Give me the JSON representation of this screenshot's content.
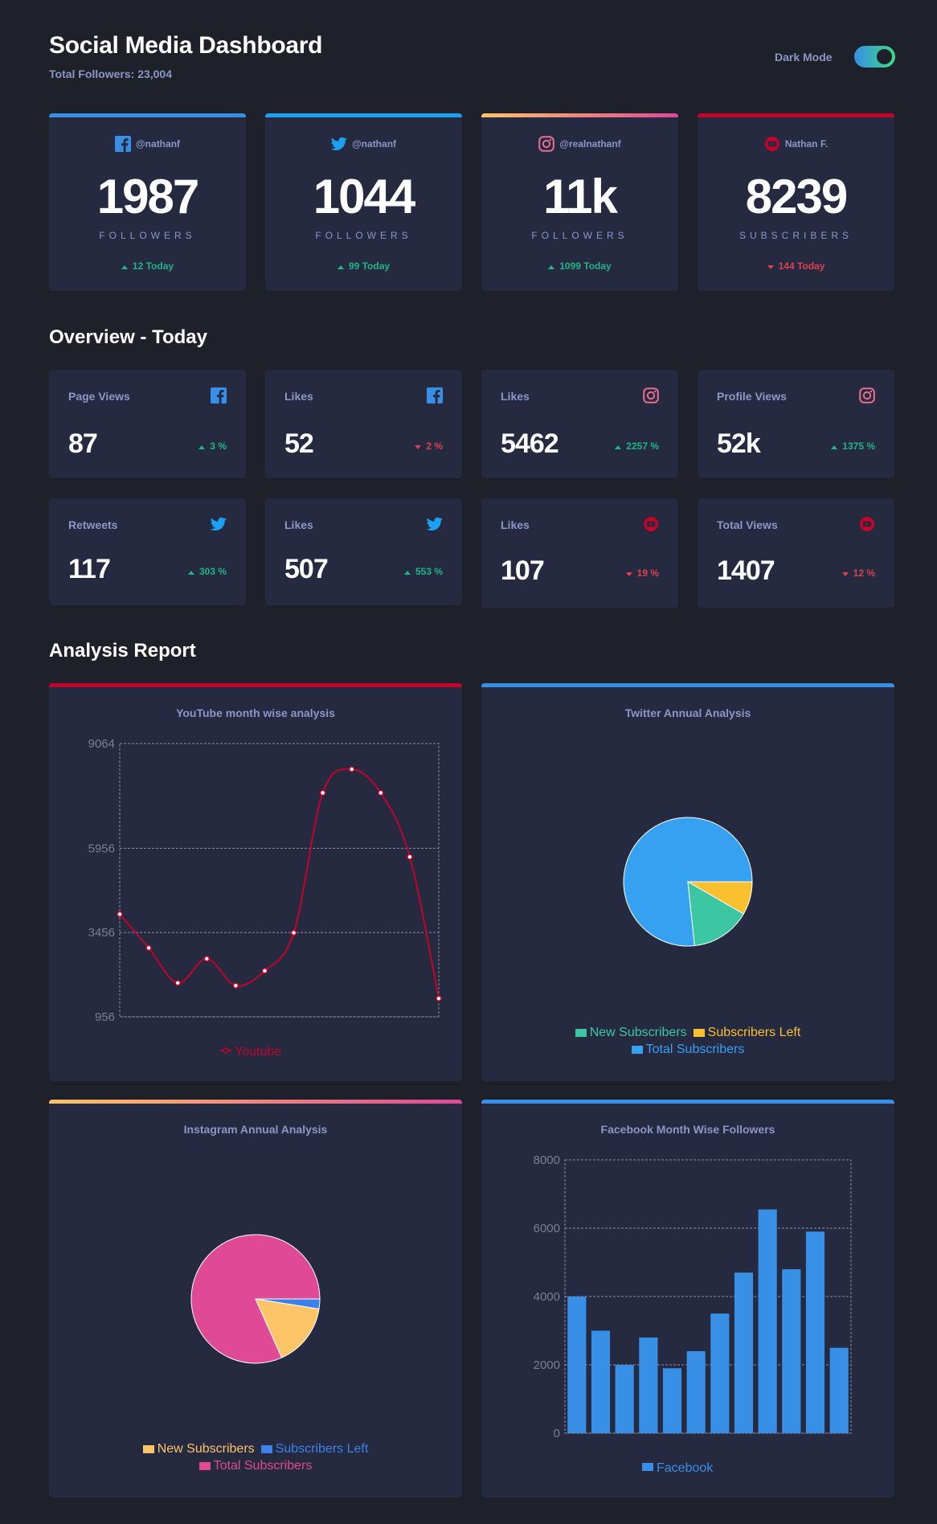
{
  "header": {
    "title": "Social Media Dashboard",
    "total_followers": "Total Followers: 23,004",
    "dark_mode_label": "Dark Mode"
  },
  "colors": {
    "facebook": "#378fe6",
    "twitter": "#1ca0f2",
    "instagram_gradient": [
      "#fdc468",
      "#df4996"
    ],
    "youtube": "#c4032a",
    "up": "#1eb589",
    "down": "#dc414c"
  },
  "platform_cards": [
    {
      "icon": "facebook-icon",
      "handle": "@nathanf",
      "count": "1987",
      "unit": "FOLLOWERS",
      "today": "12 Today",
      "trend": "up"
    },
    {
      "icon": "twitter-icon",
      "handle": "@nathanf",
      "count": "1044",
      "unit": "FOLLOWERS",
      "today": "99 Today",
      "trend": "up"
    },
    {
      "icon": "instagram-icon",
      "handle": "@realnathanf",
      "count": "11k",
      "unit": "FOLLOWERS",
      "today": "1099 Today",
      "trend": "up"
    },
    {
      "icon": "youtube-icon",
      "handle": "Nathan F.",
      "count": "8239",
      "unit": "SUBSCRIBERS",
      "today": "144 Today",
      "trend": "down"
    }
  ],
  "overview": {
    "title": "Overview - Today",
    "cards": [
      {
        "label": "Page Views",
        "icon": "facebook-icon",
        "value": "87",
        "pct": "3 %",
        "trend": "up"
      },
      {
        "label": "Likes",
        "icon": "facebook-icon",
        "value": "52",
        "pct": "2 %",
        "trend": "down"
      },
      {
        "label": "Likes",
        "icon": "instagram-icon",
        "value": "5462",
        "pct": "2257 %",
        "trend": "up"
      },
      {
        "label": "Profile Views",
        "icon": "instagram-icon",
        "value": "52k",
        "pct": "1375 %",
        "trend": "up"
      },
      {
        "label": "Retweets",
        "icon": "twitter-icon",
        "value": "117",
        "pct": "303 %",
        "trend": "up"
      },
      {
        "label": "Likes",
        "icon": "twitter-icon",
        "value": "507",
        "pct": "553 %",
        "trend": "up"
      },
      {
        "label": "Likes",
        "icon": "youtube-icon",
        "value": "107",
        "pct": "19 %",
        "trend": "down"
      },
      {
        "label": "Total Views",
        "icon": "youtube-icon",
        "value": "1407",
        "pct": "12 %",
        "trend": "down"
      }
    ]
  },
  "analysis": {
    "title": "Analysis Report",
    "youtube_title": "YouTube month wise analysis",
    "twitter_title": "Twitter Annual Analysis",
    "instagram_title": "Instagram Annual Analysis",
    "facebook_title": "Facebook Month Wise Followers"
  },
  "chart_data": [
    {
      "type": "line",
      "title": "YouTube month wise analysis",
      "ylim": [
        956,
        9064
      ],
      "yticks": [
        "9064",
        "5956",
        "3456",
        "956"
      ],
      "grid": true,
      "legend_position": "bottom",
      "series": [
        {
          "name": "Youtube",
          "color": "#c4032a",
          "values": [
            4000,
            3000,
            1960,
            2680,
            1880,
            2320,
            3450,
            7600,
            8300,
            7600,
            5700,
            1500
          ]
        }
      ]
    },
    {
      "type": "pie",
      "title": "Twitter Annual Analysis",
      "legend_position": "bottom",
      "series": [
        {
          "name": "Total Subscribers",
          "color": "#36a1f1",
          "value": 79
        },
        {
          "name": "New Subscribers",
          "color": "#3dc6a2",
          "value": 14
        },
        {
          "name": "Subscribers Left",
          "color": "#fbc02d",
          "value": 7
        }
      ]
    },
    {
      "type": "pie",
      "title": "Instagram Annual Analysis",
      "legend_position": "bottom",
      "series": [
        {
          "name": "Total Subscribers",
          "color": "#df4996",
          "value": 82
        },
        {
          "name": "New Subscribers",
          "color": "#fdc468",
          "value": 15
        },
        {
          "name": "Subscribers Left",
          "color": "#3a81ea",
          "value": 3
        }
      ]
    },
    {
      "type": "bar",
      "title": "Facebook Month Wise Followers",
      "ylim": [
        0,
        8000
      ],
      "yticks": [
        "8000",
        "6000",
        "4000",
        "2000",
        "0"
      ],
      "grid": true,
      "legend_position": "bottom",
      "series": [
        {
          "name": "Facebook",
          "color": "#378fe6",
          "values": [
            4000,
            3000,
            2000,
            2800,
            1900,
            2400,
            3500,
            4700,
            6550,
            4800,
            5900,
            2500
          ]
        }
      ]
    }
  ]
}
